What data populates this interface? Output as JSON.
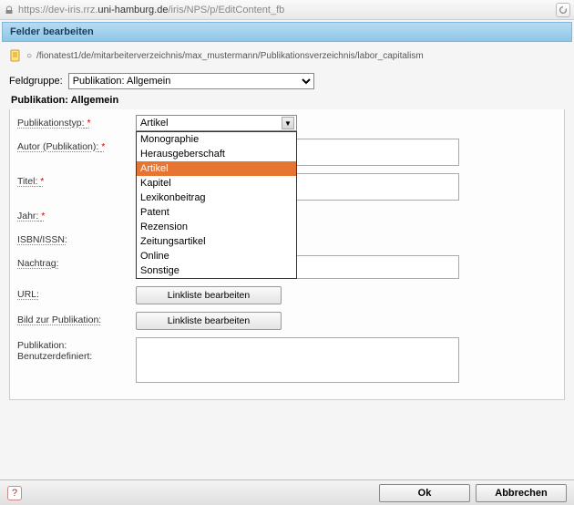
{
  "browser": {
    "url_pre": "https://dev-iris.rrz.",
    "url_domain": "uni-hamburg.de",
    "url_post": "/iris/NPS/p/EditContent_fb"
  },
  "title_bar": "Felder bearbeiten",
  "breadcrumb": "/fionatest1/de/mitarbeiterverzeichnis/max_mustermann/Publikationsverzeichnis/labor_capitalism",
  "fieldgroup": {
    "label": "Feldgruppe:",
    "value": "Publikation: Allgemein"
  },
  "section_header": "Publikation: Allgemein",
  "form": {
    "pub_type": {
      "label": "Publikationstyp:",
      "value": "Artikel"
    },
    "dropdown_options": [
      {
        "label": "Monographie",
        "active": false
      },
      {
        "label": "Herausgeberschaft",
        "active": false
      },
      {
        "label": "Artikel",
        "active": true
      },
      {
        "label": "Kapitel",
        "active": false
      },
      {
        "label": "Lexikonbeitrag",
        "active": false
      },
      {
        "label": "Patent",
        "active": false
      },
      {
        "label": "Rezension",
        "active": false
      },
      {
        "label": "Zeitungsartikel",
        "active": false
      },
      {
        "label": "Online",
        "active": false
      },
      {
        "label": "Sonstige",
        "active": false
      }
    ],
    "author": {
      "label": "Autor (Publikation):"
    },
    "title": {
      "label": "Titel:"
    },
    "year": {
      "label": "Jahr:"
    },
    "isbn": {
      "label": "ISBN/ISSN:"
    },
    "nachtrag": {
      "label": "Nachtrag:"
    },
    "url": {
      "label": "URL:",
      "button": "Linkliste bearbeiten"
    },
    "image": {
      "label": "Bild zur Publikation:",
      "button": "Linkliste bearbeiten"
    },
    "userdefined": {
      "label": "Publikation: Benutzerdefiniert:"
    }
  },
  "footer": {
    "ok": "Ok",
    "cancel": "Abbrechen"
  }
}
